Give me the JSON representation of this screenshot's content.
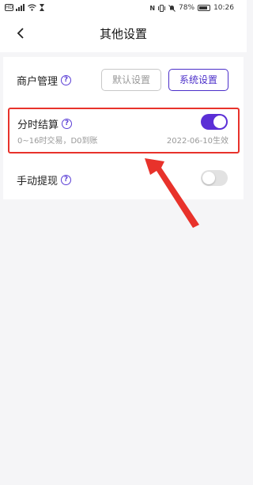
{
  "statusbar": {
    "left_box_text": "HD",
    "battery": "78%",
    "time": "10:26",
    "nfc_label": "N"
  },
  "header": {
    "title": "其他设置"
  },
  "merchant": {
    "label": "商户管理",
    "default_button": "默认设置",
    "system_button": "系统设置"
  },
  "split_settlement": {
    "label": "分时结算",
    "enabled": true,
    "description": "0~16时交易，D0到账",
    "effective": "2022-06-10生效"
  },
  "manual_withdraw": {
    "label": "手动提现",
    "enabled": false
  },
  "help_glyph": "?",
  "colors": {
    "accent": "#5b2fd6",
    "highlight_border": "#e8322b",
    "arrow": "#e8322b",
    "toggle_off": "#e2e2e2"
  }
}
